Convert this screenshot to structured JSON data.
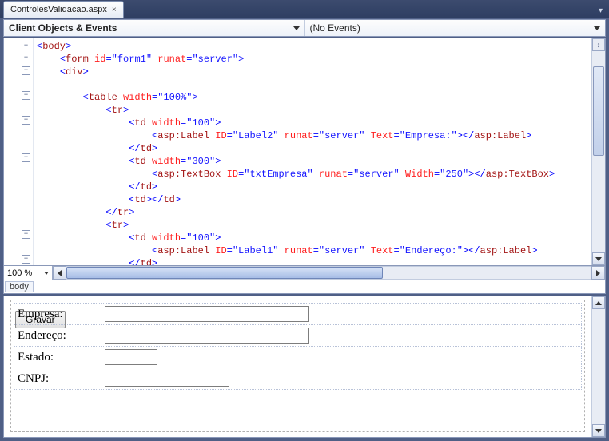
{
  "tab": {
    "title": "ControlesValidacao.aspx"
  },
  "dropdowns": {
    "left": "Client Objects & Events",
    "right": "(No Events)"
  },
  "zoom": "100 %",
  "breadcrumb": "body",
  "gutter_marks": [
    "−",
    "−",
    "−",
    "",
    "−",
    "",
    "−",
    "",
    "",
    "−",
    "",
    "",
    "",
    "",
    "",
    "−",
    "",
    "−"
  ],
  "code_lines": [
    [
      [
        "br",
        "<"
      ],
      [
        "tag",
        "body"
      ],
      [
        "br",
        ">"
      ]
    ],
    [
      [
        "pl",
        "    "
      ],
      [
        "br",
        "<"
      ],
      [
        "tag",
        "form"
      ],
      [
        "pl",
        " "
      ],
      [
        "attr",
        "id"
      ],
      [
        "br",
        "="
      ],
      [
        "val",
        "\"form1\""
      ],
      [
        "pl",
        " "
      ],
      [
        "attr",
        "runat"
      ],
      [
        "br",
        "="
      ],
      [
        "val",
        "\"server\""
      ],
      [
        "br",
        ">"
      ]
    ],
    [
      [
        "pl",
        "    "
      ],
      [
        "br",
        "<"
      ],
      [
        "tag",
        "div"
      ],
      [
        "br",
        ">"
      ]
    ],
    [
      [
        "pl",
        " "
      ]
    ],
    [
      [
        "pl",
        "        "
      ],
      [
        "br",
        "<"
      ],
      [
        "tag",
        "table"
      ],
      [
        "pl",
        " "
      ],
      [
        "attr",
        "width"
      ],
      [
        "br",
        "="
      ],
      [
        "val",
        "\"100%\""
      ],
      [
        "br",
        ">"
      ]
    ],
    [
      [
        "pl",
        "            "
      ],
      [
        "br",
        "<"
      ],
      [
        "tag",
        "tr"
      ],
      [
        "br",
        ">"
      ]
    ],
    [
      [
        "pl",
        "                "
      ],
      [
        "br",
        "<"
      ],
      [
        "tag",
        "td"
      ],
      [
        "pl",
        " "
      ],
      [
        "attr",
        "width"
      ],
      [
        "br",
        "="
      ],
      [
        "val",
        "\"100\""
      ],
      [
        "br",
        ">"
      ]
    ],
    [
      [
        "pl",
        "                    "
      ],
      [
        "br",
        "<"
      ],
      [
        "tag",
        "asp:Label"
      ],
      [
        "pl",
        " "
      ],
      [
        "attr",
        "ID"
      ],
      [
        "br",
        "="
      ],
      [
        "val",
        "\"Label2\""
      ],
      [
        "pl",
        " "
      ],
      [
        "attr",
        "runat"
      ],
      [
        "br",
        "="
      ],
      [
        "val",
        "\"server\""
      ],
      [
        "pl",
        " "
      ],
      [
        "attr",
        "Text"
      ],
      [
        "br",
        "="
      ],
      [
        "val",
        "\"Empresa:\""
      ],
      [
        "br",
        "></"
      ],
      [
        "tag",
        "asp:Label"
      ],
      [
        "br",
        ">"
      ]
    ],
    [
      [
        "pl",
        "                "
      ],
      [
        "br",
        "</"
      ],
      [
        "tag",
        "td"
      ],
      [
        "br",
        ">"
      ]
    ],
    [
      [
        "pl",
        "                "
      ],
      [
        "br",
        "<"
      ],
      [
        "tag",
        "td"
      ],
      [
        "pl",
        " "
      ],
      [
        "attr",
        "width"
      ],
      [
        "br",
        "="
      ],
      [
        "val",
        "\"300\""
      ],
      [
        "br",
        ">"
      ]
    ],
    [
      [
        "pl",
        "                    "
      ],
      [
        "br",
        "<"
      ],
      [
        "tag",
        "asp:TextBox"
      ],
      [
        "pl",
        " "
      ],
      [
        "attr",
        "ID"
      ],
      [
        "br",
        "="
      ],
      [
        "val",
        "\"txtEmpresa\""
      ],
      [
        "pl",
        " "
      ],
      [
        "attr",
        "runat"
      ],
      [
        "br",
        "="
      ],
      [
        "val",
        "\"server\""
      ],
      [
        "pl",
        " "
      ],
      [
        "attr",
        "Width"
      ],
      [
        "br",
        "="
      ],
      [
        "val",
        "\"250\""
      ],
      [
        "br",
        "></"
      ],
      [
        "tag",
        "asp:TextBox"
      ],
      [
        "br",
        ">"
      ]
    ],
    [
      [
        "pl",
        "                "
      ],
      [
        "br",
        "</"
      ],
      [
        "tag",
        "td"
      ],
      [
        "br",
        ">"
      ]
    ],
    [
      [
        "pl",
        "                "
      ],
      [
        "br",
        "<"
      ],
      [
        "tag",
        "td"
      ],
      [
        "br",
        "></"
      ],
      [
        "tag",
        "td"
      ],
      [
        "br",
        ">"
      ]
    ],
    [
      [
        "pl",
        "            "
      ],
      [
        "br",
        "</"
      ],
      [
        "tag",
        "tr"
      ],
      [
        "br",
        ">"
      ]
    ],
    [
      [
        "pl",
        "            "
      ],
      [
        "br",
        "<"
      ],
      [
        "tag",
        "tr"
      ],
      [
        "br",
        ">"
      ]
    ],
    [
      [
        "pl",
        "                "
      ],
      [
        "br",
        "<"
      ],
      [
        "tag",
        "td"
      ],
      [
        "pl",
        " "
      ],
      [
        "attr",
        "width"
      ],
      [
        "br",
        "="
      ],
      [
        "val",
        "\"100\""
      ],
      [
        "br",
        ">"
      ]
    ],
    [
      [
        "pl",
        "                    "
      ],
      [
        "br",
        "<"
      ],
      [
        "tag",
        "asp:Label"
      ],
      [
        "pl",
        " "
      ],
      [
        "attr",
        "ID"
      ],
      [
        "br",
        "="
      ],
      [
        "val",
        "\"Label1\""
      ],
      [
        "pl",
        " "
      ],
      [
        "attr",
        "runat"
      ],
      [
        "br",
        "="
      ],
      [
        "val",
        "\"server\""
      ],
      [
        "pl",
        " "
      ],
      [
        "attr",
        "Text"
      ],
      [
        "br",
        "="
      ],
      [
        "val",
        "\"Endereço:\""
      ],
      [
        "br",
        "></"
      ],
      [
        "tag",
        "asp:Label"
      ],
      [
        "br",
        ">"
      ]
    ],
    [
      [
        "pl",
        "                "
      ],
      [
        "br",
        "</"
      ],
      [
        "tag",
        "td"
      ],
      [
        "br",
        ">"
      ]
    ]
  ],
  "designer": {
    "rows": [
      {
        "label": "Empresa:",
        "width_class": "w250"
      },
      {
        "label": "Endereço:",
        "width_class": "w250"
      },
      {
        "label": "Estado:",
        "width_class": "w60"
      },
      {
        "label": "CNPJ:",
        "width_class": "w150"
      }
    ],
    "button": "Gravar"
  }
}
